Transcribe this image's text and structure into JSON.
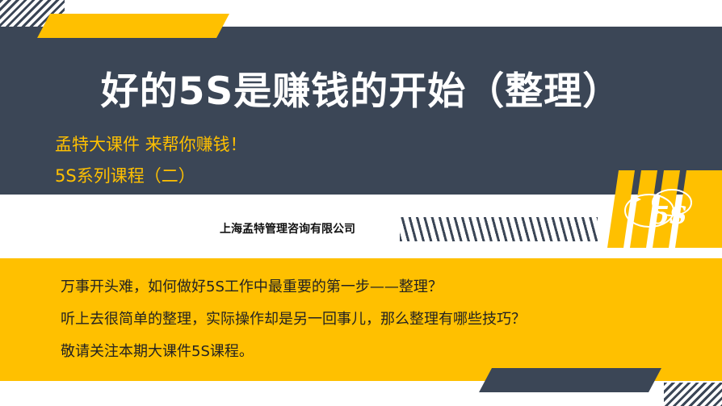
{
  "slide": {
    "title": "好的5S是赚钱的开始（整理）",
    "subtitle_line1": "孟特大课件 来帮你赚钱！",
    "subtitle_line2": "5S系列课程（二）",
    "company": "上海孟特管理咨询有限公司",
    "logo_text": "5S",
    "body_lines": [
      "万事开头难，如何做好5S工作中最重要的第一步——整理？",
      "听上去很简单的整理，实际操作却是另一回事儿，那么整理有哪些技巧？",
      "敬请关注本期大课件5S课程。"
    ]
  },
  "colors": {
    "accent_yellow": "#ffc000",
    "dark_slate": "#3b4656",
    "white": "#ffffff"
  }
}
